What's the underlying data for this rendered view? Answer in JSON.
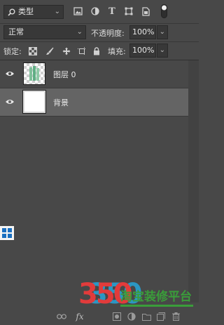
{
  "filter": {
    "kind_value": "类型"
  },
  "blend": {
    "mode_value": "正常",
    "opacity_label": "不透明度:",
    "opacity_value": "100%"
  },
  "lock": {
    "label": "锁定:",
    "fill_label": "填充:",
    "fill_value": "100%"
  },
  "layers": [
    {
      "name": "图层 0",
      "selected": false
    },
    {
      "name": "背景",
      "selected": true
    }
  ],
  "watermark": {
    "digits": "350",
    "text": "淘宝装修平台"
  },
  "colors": {
    "panel": "#484848",
    "selected_row": "#646464",
    "accent": "#1a6fc0"
  }
}
